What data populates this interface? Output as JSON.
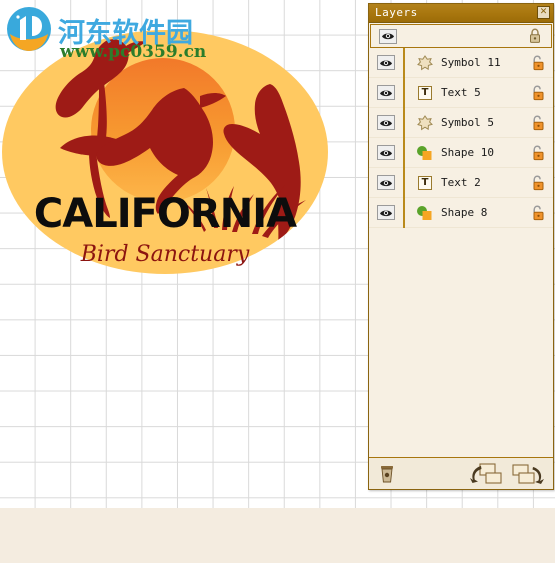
{
  "canvas": {
    "grid_color": "#d9d9d9",
    "background": "#ffffff",
    "footer_strip_color": "#f4ece0"
  },
  "artwork": {
    "name": "california-bird-sanctuary-logo",
    "title_text": "CALIFORNIA",
    "subtitle_text": "Bird Sanctuary",
    "ellipse_color": "#FFC961",
    "sun_top_color": "#F2792A",
    "sun_bottom_color": "#FBB040",
    "bird_color": "#9E1B16",
    "title_color": "#0d0d0d",
    "subtitle_color": "#8C1410"
  },
  "watermark": {
    "site_name": "河东软件园",
    "url": "www.pc0359.cn",
    "site_color": "#3fa9e0",
    "url_color": "#2b7d2b"
  },
  "panel": {
    "title": "Layers",
    "close_label": "✕",
    "titlebar_color": "#a8760e",
    "background_color": "#f7f0e3",
    "border_color": "#8a6410",
    "rows": [
      {
        "label": "",
        "type": "root",
        "visible": true,
        "locked": true,
        "selected": true,
        "indented": false
      },
      {
        "label": "Symbol 11",
        "type": "symbol",
        "visible": true,
        "locked": false,
        "selected": false,
        "indented": true
      },
      {
        "label": "Text 5",
        "type": "text",
        "visible": true,
        "locked": false,
        "selected": false,
        "indented": true
      },
      {
        "label": "Symbol 5",
        "type": "symbol",
        "visible": true,
        "locked": false,
        "selected": false,
        "indented": true
      },
      {
        "label": "Shape 10",
        "type": "shape",
        "visible": true,
        "locked": false,
        "selected": false,
        "indented": true
      },
      {
        "label": "Text 2",
        "type": "text",
        "visible": true,
        "locked": false,
        "selected": false,
        "indented": true
      },
      {
        "label": "Shape 8",
        "type": "shape",
        "visible": true,
        "locked": false,
        "selected": false,
        "indented": true
      }
    ],
    "footer": {
      "delete_label": "Delete Layer",
      "group_label": "Group",
      "ungroup_label": "Ungroup"
    },
    "icons": {
      "eye": "eye-icon",
      "lock_closed": "lock-closed-icon",
      "lock_open": "lock-open-icon",
      "symbol": "symbol-icon",
      "text": "T",
      "shape": "shape-icon",
      "trash": "trash-icon",
      "group": "group-icon",
      "ungroup": "ungroup-icon",
      "close": "close-icon"
    }
  }
}
